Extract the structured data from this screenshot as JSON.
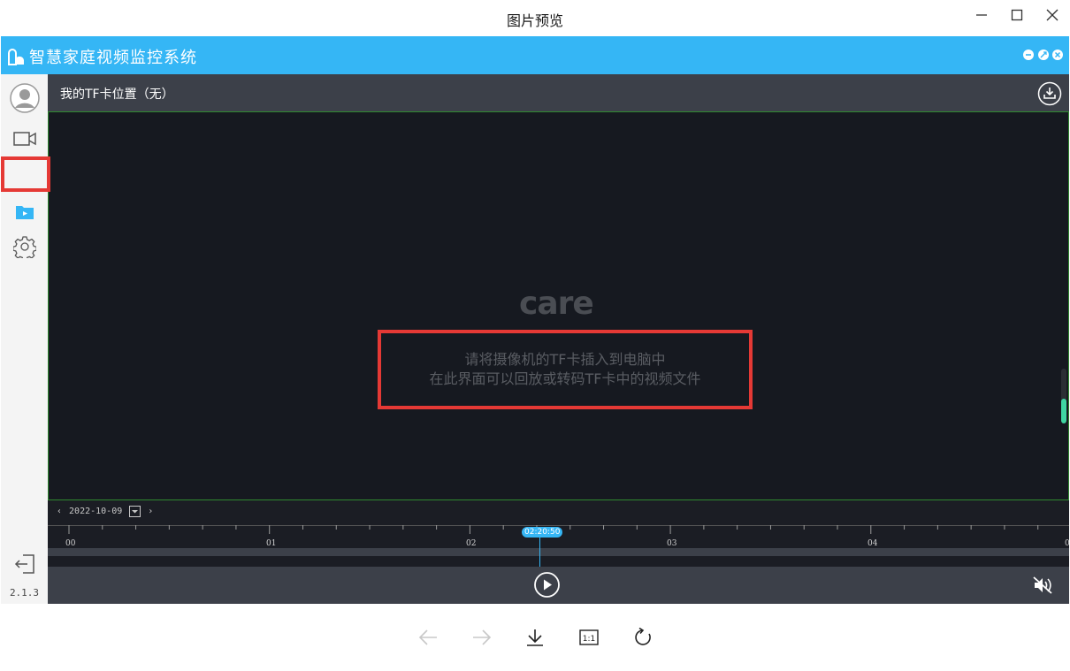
{
  "window": {
    "title": "图片预览",
    "controls": [
      "minimize-icon",
      "maximize-icon",
      "close-icon"
    ]
  },
  "app": {
    "title": "智慧家庭视频监控系统",
    "accent_color": "#35b6f5",
    "header_controls": [
      "minimize-icon",
      "restore-icon",
      "close-icon"
    ]
  },
  "sidebar": {
    "items": [
      {
        "icon": "user-avatar-icon"
      },
      {
        "icon": "video-camera-icon"
      },
      {
        "icon": "folder-play-icon",
        "selected": true
      },
      {
        "icon": "settings-gear-icon"
      }
    ],
    "logout_icon": "logout-icon",
    "version": "2.1.3"
  },
  "main": {
    "header_title": "我的TF卡位置（无）",
    "download_icon": "download-icon",
    "logo_text": "care",
    "message_line1": "请将摄像机的TF卡插入到电脑中",
    "message_line2": "在此界面可以回放或转码TF卡中的视频文件",
    "volume_level": 0.45
  },
  "timeline": {
    "date": "2022-10-09",
    "prev_icon": "chevron-left-icon",
    "next_icon": "chevron-right-icon",
    "calendar_icon": "calendar-dropdown-icon",
    "hours": [
      "00",
      "01",
      "02",
      "03",
      "04",
      "0"
    ],
    "current_time": "02:20:50"
  },
  "controls": {
    "play_icon": "play-circle-icon",
    "mute_icon": "volume-mute-icon"
  },
  "toolbar": {
    "items": [
      "arrow-left-icon",
      "arrow-right-icon",
      "download-icon",
      "actual-size-icon",
      "rotate-icon"
    ],
    "actual_size_label": "1:1"
  }
}
